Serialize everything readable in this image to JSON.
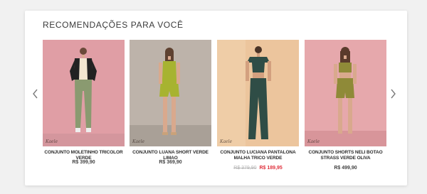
{
  "section": {
    "title": "RECOMENDAÇÕES PARA VOCÊ"
  },
  "carousel": {
    "prev_icon": "chevron-left-icon",
    "next_icon": "chevron-right-icon"
  },
  "products": [
    {
      "name": "CONJUNTO MOLETINHO TRICOLOR VERDE",
      "price": "R$ 399,90",
      "watermark": "Kaele",
      "bg": "#e3a7ad",
      "outfit": "#8a9a70"
    },
    {
      "name": "CONJUNTO LUANA SHORT VERDE LIMAO",
      "price": "R$ 369,90",
      "watermark": "Kaele",
      "bg": "#bdb3aa",
      "outfit": "#a7b330"
    },
    {
      "name": "CONJUNTO LUCIANA PANTALONA MALHA TRICO VERDE",
      "old_price": "R$ 379,90",
      "price": "R$ 189,95",
      "watermark": "Kaele",
      "bg": "#ecc59d",
      "outfit": "#2f4d46"
    },
    {
      "name": "CONJUNTO SHORTS NELI BOTAO STRASS VERDE OLIVA",
      "price": "R$ 499,90",
      "watermark": "Kaele",
      "bg": "#e6a8ac",
      "outfit": "#8f8a38"
    }
  ],
  "colors": {
    "sale_price": "#e0323e",
    "old_price": "#b5b5b5",
    "title_text": "#3a3a3a"
  }
}
